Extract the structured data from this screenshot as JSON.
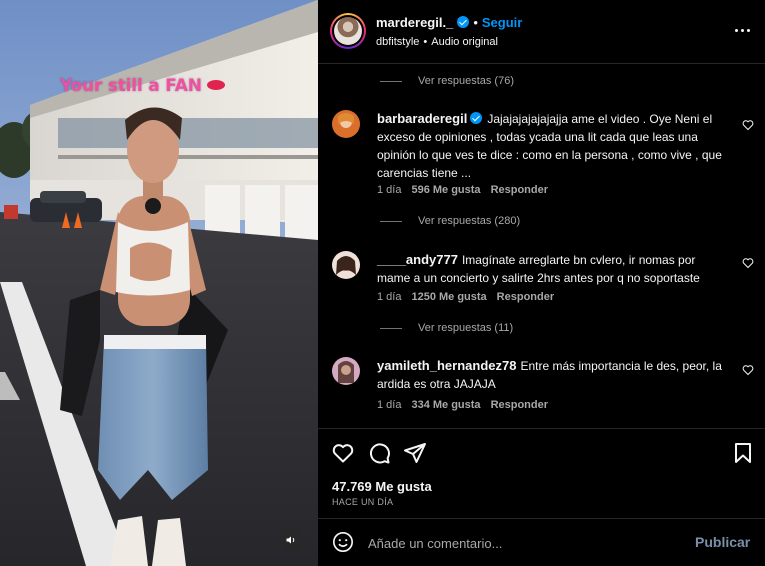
{
  "media": {
    "overlay_text": "Your still a FAN",
    "audio_icon": "speaker-icon"
  },
  "header": {
    "username": "marderegil._",
    "separator": "•",
    "follow_label": "Seguir",
    "audio_user": "dbfitstyle",
    "audio_separator": "•",
    "audio_label": "Audio original",
    "more_icon": "more-options-icon"
  },
  "thread": {
    "replies_top": "Ver respuestas (76)",
    "comments": [
      {
        "username": "barbaraderegil",
        "verified": true,
        "text": "Jajajajajajajajja ame el video . Oye Neni el exceso de opiniones , todas ycada una lit cada que leas una opinión lo que ves te dice : como en la persona , como vive , que carencias tiene ...",
        "time": "1 día",
        "likes": "596 Me gusta",
        "reply_label": "Responder",
        "replies": "Ver respuestas (280)"
      },
      {
        "username": "____andy777",
        "verified": false,
        "text": "Imagínate arreglarte bn cvlero, ir nomas por mame a un concierto y salirte 2hrs antes por q no soportaste",
        "time": "1 día",
        "likes": "1250 Me gusta",
        "reply_label": "Responder",
        "replies": "Ver respuestas (11)"
      },
      {
        "username": "yamileth_hernandez78",
        "verified": false,
        "text": "Entre más importancia le des, peor, la ardida es otra JAJAJA",
        "time": "1 día",
        "likes": "334 Me gusta",
        "reply_label": "Responder",
        "replies": ""
      }
    ]
  },
  "footer": {
    "likes": "47.769 Me gusta",
    "posted": "HACE UN DÍA",
    "comment_placeholder": "Añade un comentario...",
    "publish_label": "Publicar"
  },
  "colors": {
    "accent": "#0095f6",
    "background": "#000000",
    "overlay_text": "#f04fa3",
    "muted": "#a8a8a8"
  }
}
